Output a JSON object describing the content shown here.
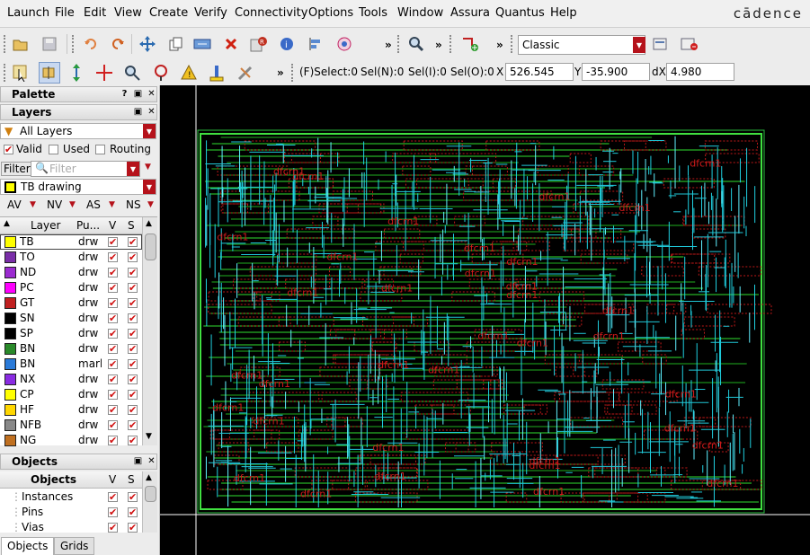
{
  "menu": [
    "Launch",
    "File",
    "Edit",
    "View",
    "Create",
    "Verify",
    "Connectivity",
    "Options",
    "Tools",
    "Window",
    "Assura",
    "Quantus",
    "Help"
  ],
  "brand": "cādence",
  "toolbar": {
    "workspace": "Classic",
    "overflow": "»"
  },
  "status": {
    "fselect": "(F)Select:0",
    "seln": "Sel(N):0",
    "seli": "Sel(I):0",
    "selo": "Sel(O):0",
    "x_label": "X",
    "x_value": "526.545",
    "y_label": "Y",
    "y_value": "-35.900",
    "dx_label": "dX",
    "dx_value": "4.980"
  },
  "palette": {
    "title": "Palette",
    "layers_title": "Layers",
    "filter_all": "All Layers",
    "valid": "Valid",
    "used": "Used",
    "routing": "Routing",
    "filter_label": "Filter",
    "filter_placeholder": "Filter",
    "current_layer": "TB drawing",
    "vis": [
      "AV",
      "NV",
      "AS",
      "NS"
    ],
    "columns": {
      "layer": "Layer",
      "purpose": "Pu...",
      "v": "V",
      "s": "S"
    },
    "layers": [
      {
        "name": "TB",
        "purpose": "drw",
        "color": "#ffff00"
      },
      {
        "name": "TO",
        "purpose": "drw",
        "color": "#7a2ea8"
      },
      {
        "name": "ND",
        "purpose": "drw",
        "color": "#9b2bd0"
      },
      {
        "name": "PC",
        "purpose": "drw",
        "color": "#ff00ff"
      },
      {
        "name": "GT",
        "purpose": "drw",
        "color": "#c02020"
      },
      {
        "name": "SN",
        "purpose": "drw",
        "color": "#000000"
      },
      {
        "name": "SP",
        "purpose": "drw",
        "color": "#000000"
      },
      {
        "name": "BN",
        "purpose": "drw",
        "color": "#2a8a2a"
      },
      {
        "name": "BN",
        "purpose": "mark",
        "color": "#2a7ad8"
      },
      {
        "name": "NX",
        "purpose": "drw",
        "color": "#8a2be2"
      },
      {
        "name": "CP",
        "purpose": "drw",
        "color": "#ffff00"
      },
      {
        "name": "HF",
        "purpose": "drw",
        "color": "#ffd700"
      },
      {
        "name": "NFB",
        "purpose": "drw",
        "color": "#888888"
      },
      {
        "name": "NG",
        "purpose": "drw",
        "color": "#c07020"
      }
    ]
  },
  "objects": {
    "title": "Objects",
    "columns": {
      "objects": "Objects",
      "v": "V",
      "s": "S"
    },
    "items": [
      "Instances",
      "Pins",
      "Vias"
    ]
  },
  "tabs": [
    "Objects",
    "Grids"
  ],
  "layout_labels": [
    "dfcrn1",
    "dfcrn1",
    "dfcrn1",
    "dfcrn1",
    "dfcrn1",
    "dfcrn1",
    "dfcrn1",
    "dfcrn1",
    "dfcrn1",
    "dfcrn1"
  ]
}
